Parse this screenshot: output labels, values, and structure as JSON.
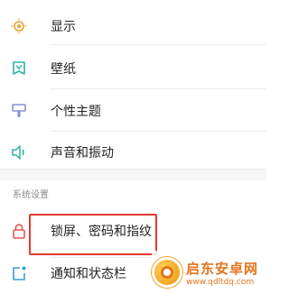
{
  "settings_items": [
    {
      "label": "显示",
      "icon": "display-icon"
    },
    {
      "label": "壁纸",
      "icon": "wallpaper-icon"
    },
    {
      "label": "个性主题",
      "icon": "theme-icon"
    },
    {
      "label": "声音和振动",
      "icon": "sound-icon"
    }
  ],
  "section": {
    "header": "系统设置",
    "items": [
      {
        "label": "锁屏、密码和指纹",
        "icon": "lock-icon"
      },
      {
        "label": "通知和状态栏",
        "icon": "notification-icon"
      }
    ]
  },
  "watermark": {
    "title": "启东安卓网",
    "url": "www.qdltdq.com"
  },
  "colors": {
    "highlight": "#e23a33",
    "icon_orange": "#f0a030",
    "icon_teal": "#2bb3a3",
    "icon_purple": "#8a8fd6",
    "icon_red": "#e85050",
    "icon_blue": "#3aa0d8"
  }
}
